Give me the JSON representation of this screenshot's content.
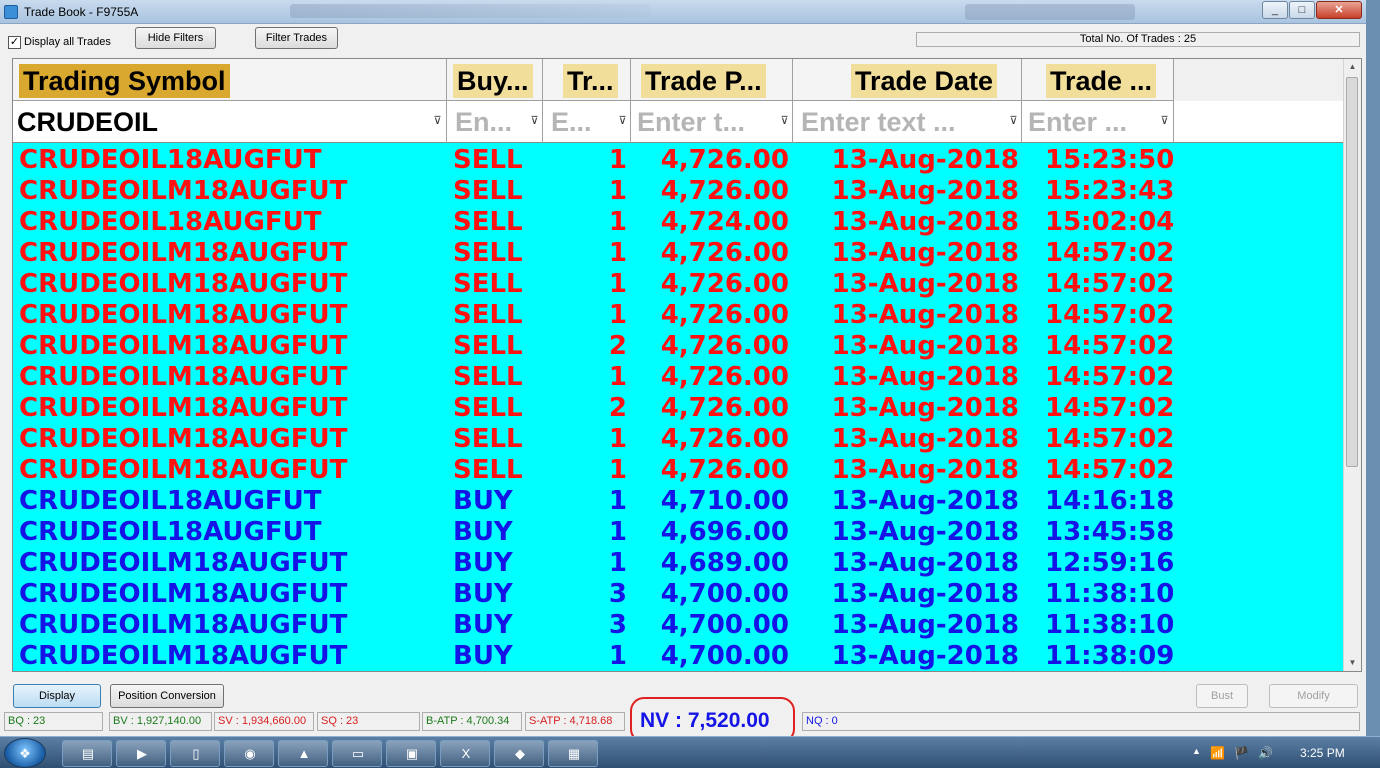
{
  "window": {
    "title": "Trade Book - F9755A",
    "buttons": [
      "_",
      "□",
      "✕"
    ]
  },
  "toolbar": {
    "display_all_checked": "✓",
    "display_all_label": "Display all Trades",
    "hide_filters_label": "Hide Filters",
    "filter_trades_label": "Filter Trades",
    "total_trades_text": "Total No. Of Trades : 25"
  },
  "grid": {
    "columns": [
      {
        "header": "Trading Symbol",
        "filter": "CRUDEOIL"
      },
      {
        "header": "Buy...",
        "filter": "En..."
      },
      {
        "header": "Tr...",
        "filter": "E..."
      },
      {
        "header": "Trade P...",
        "filter": "Enter t..."
      },
      {
        "header": "Trade Date",
        "filter": "Enter text ..."
      },
      {
        "header": "Trade ...",
        "filter": "Enter ..."
      }
    ],
    "funnel_glyph": "⊽",
    "rows": [
      {
        "side": "sell",
        "cells": [
          "CRUDEOIL18AUGFUT",
          "SELL",
          "1",
          "4,726.00",
          "13-Aug-2018",
          "15:23:50"
        ]
      },
      {
        "side": "sell",
        "cells": [
          "CRUDEOILM18AUGFUT",
          "SELL",
          "1",
          "4,726.00",
          "13-Aug-2018",
          "15:23:43"
        ]
      },
      {
        "side": "sell",
        "cells": [
          "CRUDEOIL18AUGFUT",
          "SELL",
          "1",
          "4,724.00",
          "13-Aug-2018",
          "15:02:04"
        ]
      },
      {
        "side": "sell",
        "cells": [
          "CRUDEOILM18AUGFUT",
          "SELL",
          "1",
          "4,726.00",
          "13-Aug-2018",
          "14:57:02"
        ]
      },
      {
        "side": "sell",
        "cells": [
          "CRUDEOILM18AUGFUT",
          "SELL",
          "1",
          "4,726.00",
          "13-Aug-2018",
          "14:57:02"
        ]
      },
      {
        "side": "sell",
        "cells": [
          "CRUDEOILM18AUGFUT",
          "SELL",
          "1",
          "4,726.00",
          "13-Aug-2018",
          "14:57:02"
        ]
      },
      {
        "side": "sell",
        "cells": [
          "CRUDEOILM18AUGFUT",
          "SELL",
          "2",
          "4,726.00",
          "13-Aug-2018",
          "14:57:02"
        ]
      },
      {
        "side": "sell",
        "cells": [
          "CRUDEOILM18AUGFUT",
          "SELL",
          "1",
          "4,726.00",
          "13-Aug-2018",
          "14:57:02"
        ]
      },
      {
        "side": "sell",
        "cells": [
          "CRUDEOILM18AUGFUT",
          "SELL",
          "2",
          "4,726.00",
          "13-Aug-2018",
          "14:57:02"
        ]
      },
      {
        "side": "sell",
        "cells": [
          "CRUDEOILM18AUGFUT",
          "SELL",
          "1",
          "4,726.00",
          "13-Aug-2018",
          "14:57:02"
        ]
      },
      {
        "side": "sell",
        "cells": [
          "CRUDEOILM18AUGFUT",
          "SELL",
          "1",
          "4,726.00",
          "13-Aug-2018",
          "14:57:02"
        ]
      },
      {
        "side": "buy",
        "cells": [
          "CRUDEOIL18AUGFUT",
          "BUY",
          "1",
          "4,710.00",
          "13-Aug-2018",
          "14:16:18"
        ]
      },
      {
        "side": "buy",
        "cells": [
          "CRUDEOIL18AUGFUT",
          "BUY",
          "1",
          "4,696.00",
          "13-Aug-2018",
          "13:45:58"
        ]
      },
      {
        "side": "buy",
        "cells": [
          "CRUDEOILM18AUGFUT",
          "BUY",
          "1",
          "4,689.00",
          "13-Aug-2018",
          "12:59:16"
        ]
      },
      {
        "side": "buy",
        "cells": [
          "CRUDEOILM18AUGFUT",
          "BUY",
          "3",
          "4,700.00",
          "13-Aug-2018",
          "11:38:10"
        ]
      },
      {
        "side": "buy",
        "cells": [
          "CRUDEOILM18AUGFUT",
          "BUY",
          "3",
          "4,700.00",
          "13-Aug-2018",
          "11:38:10"
        ]
      },
      {
        "side": "buy",
        "cells": [
          "CRUDEOILM18AUGFUT",
          "BUY",
          "1",
          "4,700.00",
          "13-Aug-2018",
          "11:38:09"
        ]
      }
    ],
    "colors": {
      "sell": "#ff1111",
      "buy": "#1414e6",
      "background": "#00ffff"
    }
  },
  "actions": {
    "display_label": "Display",
    "position_conversion_label": "Position Conversion",
    "bust_label": "Bust",
    "modify_label": "Modify"
  },
  "status": [
    {
      "id": "bq",
      "text": "BQ : 23",
      "color": "#1a7a1a"
    },
    {
      "id": "bv",
      "text": "BV : 1,927,140.00",
      "color": "#1a7a1a"
    },
    {
      "id": "sv",
      "text": "SV : 1,934,660.00",
      "color": "#d81e1e"
    },
    {
      "id": "sq",
      "text": "SQ : 23",
      "color": "#d81e1e"
    },
    {
      "id": "batp",
      "text": "B-ATP : 4,700.34",
      "color": "#1a7a1a"
    },
    {
      "id": "satp",
      "text": "S-ATP : 4,718.68",
      "color": "#d81e1e"
    },
    {
      "id": "nq",
      "text": "NQ : 0",
      "color": "#1414e6"
    }
  ],
  "nv": {
    "text": "NV : 7,520.00"
  },
  "taskbar": {
    "clock": "3:25 PM",
    "tasks": [
      "folder",
      "media-player",
      "document",
      "chrome",
      "app",
      "explorer",
      "window",
      "excel",
      "trading-app",
      "calculator"
    ],
    "tray": [
      "▲",
      "📶",
      "🏴",
      "🔊"
    ]
  }
}
